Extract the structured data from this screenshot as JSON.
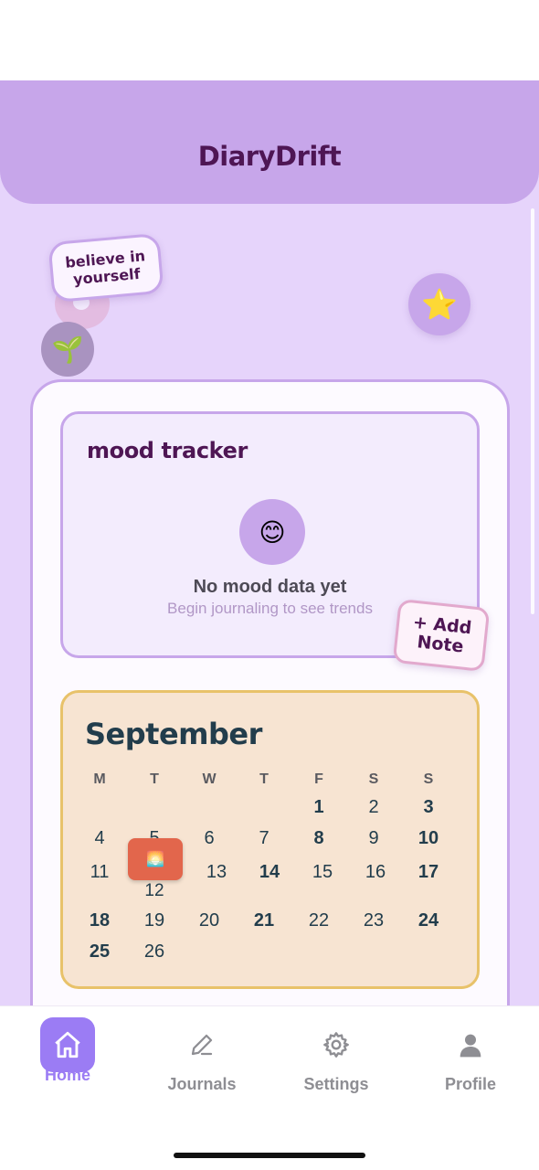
{
  "app": {
    "title": "DiaryDrift"
  },
  "stickers": {
    "believe_text": "believe in yourself",
    "sprout_emoji": "🌱",
    "star_emoji": "⭐"
  },
  "mood_tracker": {
    "title": "mood tracker",
    "face_emoji": "😊",
    "empty_title": "No mood data yet",
    "empty_subtitle": "Begin journaling to see trends",
    "add_note_label": "+ Add Note"
  },
  "calendar": {
    "month": "September",
    "weekday_headers": [
      "M",
      "T",
      "W",
      "T",
      "F",
      "S",
      "S"
    ],
    "weeks": [
      [
        "",
        "",
        "",
        "",
        "1",
        "2",
        "3"
      ],
      [
        "4",
        "5",
        "6",
        "7",
        "8",
        "9",
        "10"
      ],
      [
        "11",
        "12",
        "13",
        "14",
        "15",
        "16",
        "17"
      ],
      [
        "18",
        "19",
        "20",
        "21",
        "22",
        "23",
        "24"
      ],
      [
        "25",
        "26",
        "",
        "",
        "",
        "",
        ""
      ]
    ],
    "photo_day": "12",
    "photo_emoji": "🌅"
  },
  "tabs": [
    {
      "label": "Home",
      "icon": "home-icon",
      "active": true
    },
    {
      "label": "Journals",
      "icon": "pencil-icon",
      "active": false
    },
    {
      "label": "Settings",
      "icon": "gear-icon",
      "active": false
    },
    {
      "label": "Profile",
      "icon": "person-icon",
      "active": false
    }
  ],
  "colors": {
    "header_purple": "#c7a6ea",
    "title_purple": "#4e1654",
    "background_lavender": "#e6d4fb",
    "calendar_cream": "#f7e4d2",
    "calendar_border": "#e8c26a",
    "photo_orange": "#e2664c",
    "tab_active": "#9b7cf4"
  }
}
